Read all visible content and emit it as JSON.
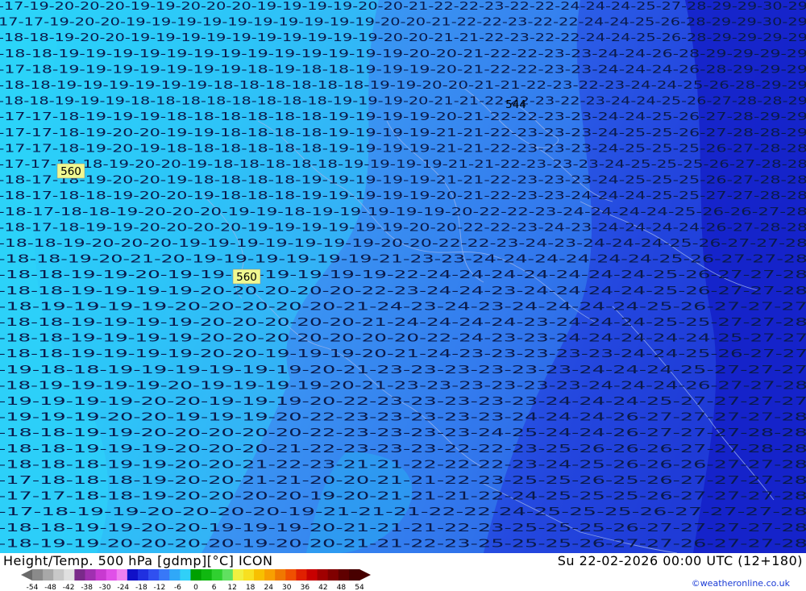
{
  "title": "Height/Temp. 500 hPa [gdmp][°C] ICON",
  "datetime": "Su 22-02-2026 00:00 UTC (12+180)",
  "credit": "©weatheronline.co.uk",
  "colorbar": {
    "labels": [
      "-54",
      "-48",
      "-42",
      "-38",
      "-30",
      "-24",
      "-18",
      "-12",
      "-6",
      "0",
      "6",
      "12",
      "18",
      "24",
      "30",
      "36",
      "42",
      "48",
      "54"
    ],
    "colors": [
      "#8a8a8a",
      "#a8a8a8",
      "#c8c8c8",
      "#e0e0e0",
      "#7a2a8a",
      "#a030b0",
      "#c83ad0",
      "#e050e8",
      "#f080f0",
      "#1010c8",
      "#2030e0",
      "#3050f0",
      "#3878f8",
      "#30a8f8",
      "#30d0f8",
      "#00a000",
      "#10b810",
      "#30d030",
      "#60e060",
      "#f0f040",
      "#f8e020",
      "#f8c000",
      "#f8a000",
      "#f07800",
      "#f05000",
      "#e02000",
      "#c80000",
      "#a00000",
      "#800000",
      "#600000",
      "#480000"
    ]
  },
  "contour_labels": [
    {
      "text": "560"
    },
    {
      "text": "560"
    },
    {
      "text": "544"
    }
  ],
  "temperature_rows": [
    "-17-19-20-20-20-19-19-20-20-20-19-19-19-19-20-20-21-22-22-23-22-22-24-24-24-25-27-28-29-29-30-29",
    "17-17-19-20-20-19-19-19-19-19-19-19-19-19-19-20-20-21-22-22-23-22-22-24-24-25-26-28-29-29-30-29",
    "-18-18-19-20-20-19-19-19-19-19-19-19-19-19-19-20-20-21-21-22-23-22-22-24-24-25-26-28-29-29-29-29",
    "-18-18-19-19-19-19-19-19-19-19-19-19-19-19-19-20-20-21-22-22-23-23-24-24-26-28-29-29-29-29",
    "-17-18-19-19-19-19-19-19-19-18-19-18-18-19-19-19-20-21-22-22-23-23-24-24-24-26-28-29-29-29",
    "-18-18-19-19-19-19-19-19-18-18-18-18-18-18-19-19-20-20-21-21-22-23-22-23-24-24-25-26-28-29-29",
    "-18-18-19-19-19-18-18-18-18-18-18-18-18-19-19-19-20-21-21-22-22-23-22-23-24-24-25-26-27-28-28-29",
    "-17-17-18-19-19-19-18-18-18-18-18-18-19-19-19-19-20-21-22-22-23-23-24-24-25-26-27-28-29-29",
    "-17-17-18-19-20-20-19-19-18-18-18-18-19-19-19-19-21-21-22-23-23-23-24-25-25-26-27-28-28-29",
    "-17-17-18-19-20-19-18-18-18-18-18-18-19-19-19-19-21-21-22-23-23-23-24-25-25-25-26-27-28-28",
    "-17-17-18-18-19-20-20-19-18-18-18-18-18-19-19-19-19-21-21-22-23-23-23-24-25-25-25-26-27-28-28",
    "-18-17-18-19-20-20-19-18-18-18-18-19-19-19-19-19-21-21-22-23-23-23-24-25-25-25-26-27-28-28",
    "-18-17-18-18-19-20-20-19-18-18-18-19-19-19-19-19-20-21-22-23-23-24-24-24-25-25-27-27-28-28",
    "-18-17-18-18-19-20-20-20-19-19-18-19-19-19-19-19-20-22-22-23-24-24-24-24-25-26-26-27-28",
    "-18-17-18-19-19-20-20-20-20-19-19-19-19-19-19-20-20-22-22-23-24-23-24-24-24-24-26-27-28-28",
    "-18-18-19-20-20-20-19-19-19-19-19-19-19-20-20-22-22-23-24-23-24-24-24-25-26-27-27-28",
    "-18-18-19-20-21-20-19-19-19-19-19-19-21-23-23-24-24-24-24-24-24-25-26-27-27-28",
    "-18-18-19-19-20-19-19-19-19-19-19-19-22-24-24-24-24-24-24-24-25-26-27-27-28",
    "-18-18-19-19-19-19-20-20-20-20-20-22-23-24-24-23-24-24-24-24-25-26-27-27-28",
    "-18-19-19-19-19-20-20-20-20-20-21-24-23-24-23-24-24-24-24-25-26-27-27-27",
    "-18-18-19-19-19-19-20-20-20-20-20-21-24-24-24-24-23-24-24-24-25-25-27-27-28",
    "-18-18-19-19-19-19-20-20-20-20-20-20-20-22-24-23-23-24-24-24-24-24-25-27-27",
    "-18-18-19-19-19-19-20-20-19-19-19-20-21-24-23-23-23-23-23-24-24-25-26-27-27",
    "-19-18-18-19-19-19-19-19-19-20-21-23-23-23-23-23-23-24-24-24-25-27-27-27",
    "-18-19-19-19-19-20-19-19-19-19-20-21-23-23-23-23-23-23-24-24-24-26-27-27-28",
    "-19-19-19-19-20-20-19-19-19-20-22-23-23-23-23-23-24-24-24-25-27-27-27-27",
    "-19-19-19-20-20-19-19-19-20-22-23-23-23-23-23-24-24-24-26-27-27-27-27-28",
    "-18-18-19-19-20-20-20-20-20-22-23-23-23-23-24-25-24-24-26-27-27-27-28-28",
    "-18-18-19-19-19-20-20-20-21-22-23-23-23-22-22-23-25-26-26-26-27-27-28-28",
    "-18-18-18-19-19-20-20-21-22-23-21-21-22-22-22-23-24-25-26-26-26-27-27-28",
    "-17-18-18-18-19-20-20-21-21-20-20-21-21-22-23-25-25-26-25-26-27-27-27-28",
    "-17-17-18-18-19-20-20-20-20-19-20-21-21-21-22-24-25-25-25-26-27-27-27-28",
    "-17-18-19-19-20-20-20-20-19-21-21-21-22-22-24-25-25-25-26-27-27-27-28",
    "-18-18-19-19-20-20-19-19-19-20-21-21-21-22-23-25-25-25-26-27-27-27-27-28",
    "-18-19-19-20-20-20-20-19-20-20-21-21-22-23-25-25-25-26-27-27-26-27-27-28"
  ]
}
